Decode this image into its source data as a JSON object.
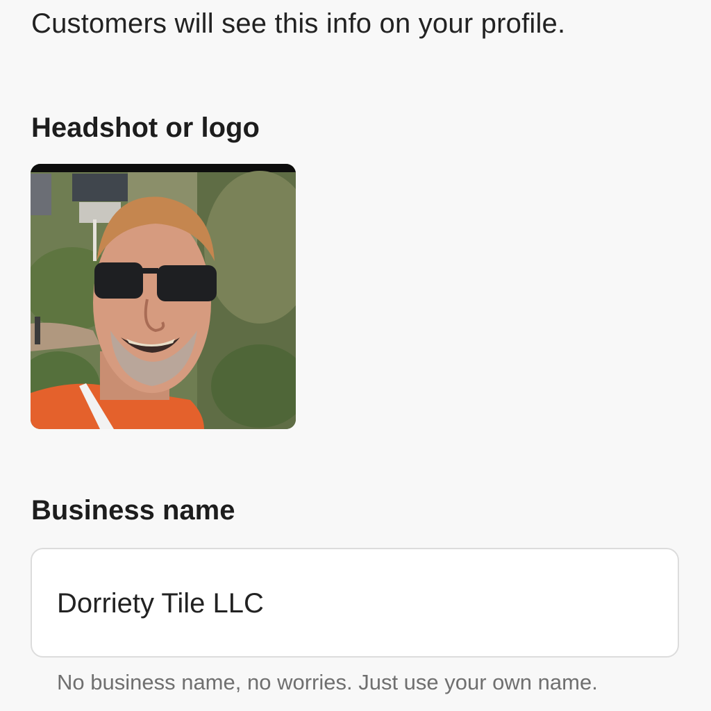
{
  "intro_text": "Customers will see this info on your profile.",
  "headshot": {
    "label": "Headshot or logo",
    "camera_icon": "camera-icon"
  },
  "business": {
    "label": "Business name",
    "value": "Dorriety Tile LLC",
    "helper": "No business name, no worries. Just use your own name."
  },
  "colors": {
    "background": "#f8f8f8",
    "input_border": "#dcdcdc",
    "text_primary": "#1f1f1f",
    "text_secondary": "#6f6f6f"
  }
}
